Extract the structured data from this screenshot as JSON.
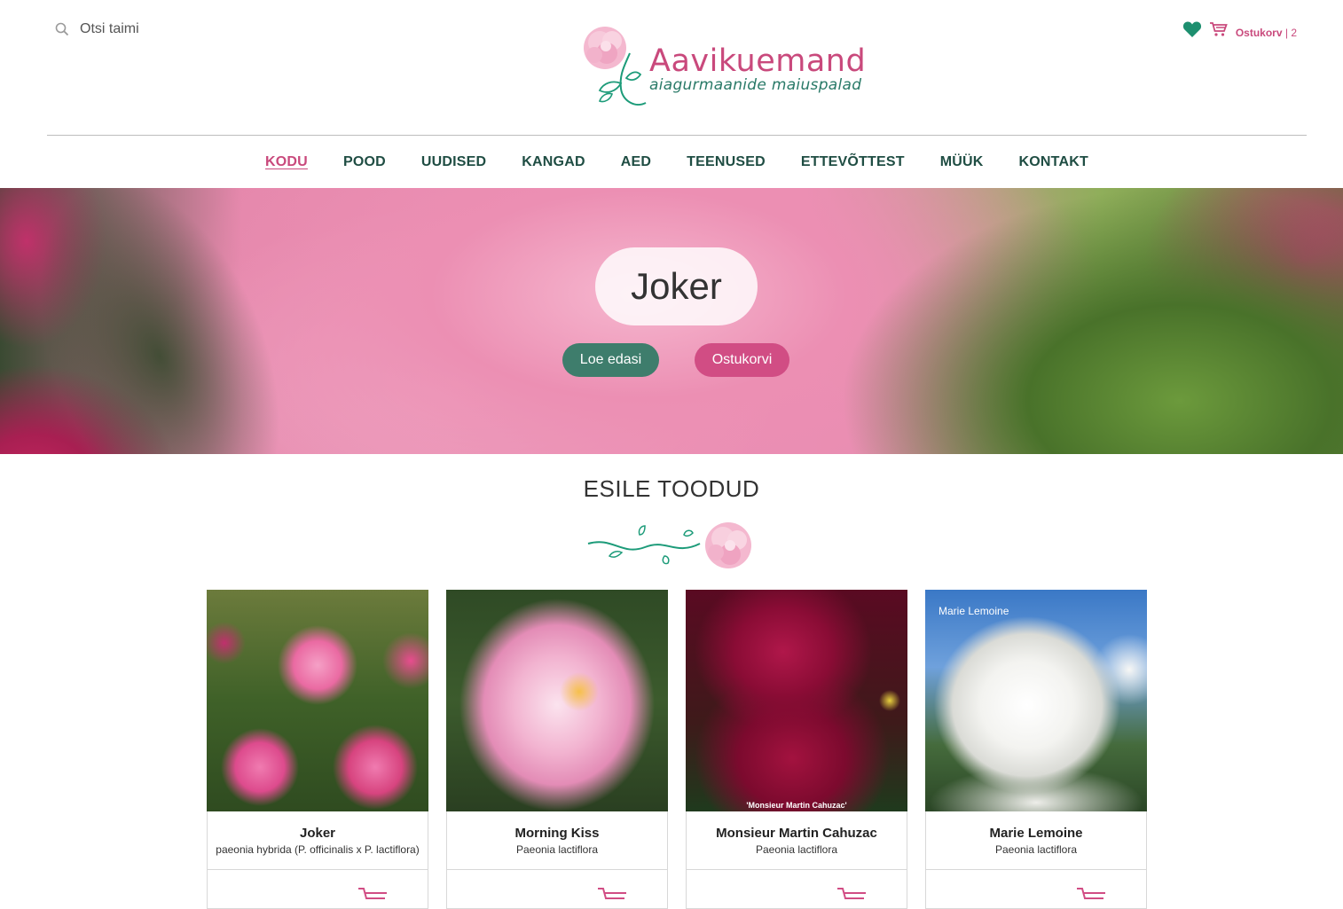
{
  "search": {
    "placeholder": "Otsi taimi"
  },
  "brand": {
    "name": "Aavikuemand",
    "tagline": "aiagurmaanide maiuspalad",
    "color": "#c9497c"
  },
  "header": {
    "cart_label": "Ostukorv",
    "cart_sep": " | ",
    "cart_count": "2"
  },
  "nav": {
    "items": [
      {
        "label": "KODU",
        "active": true
      },
      {
        "label": "POOD"
      },
      {
        "label": "UUDISED"
      },
      {
        "label": "KANGAD"
      },
      {
        "label": "AED"
      },
      {
        "label": "TEENUSED"
      },
      {
        "label": "ETTEVÕTTEST"
      },
      {
        "label": "MÜÜK"
      },
      {
        "label": "KONTAKT"
      }
    ]
  },
  "hero": {
    "title": "Joker",
    "read_more": "Loe edasi",
    "add_to_cart": "Ostukorvi"
  },
  "featured": {
    "title": "ESILE TOODUD",
    "products": [
      {
        "name": "Joker",
        "latin": "paeonia hybrida (P. officinalis x P. lactiflora)",
        "caption": ""
      },
      {
        "name": "Morning Kiss",
        "latin": "Paeonia lactiflora",
        "caption": ""
      },
      {
        "name": "Monsieur Martin Cahuzac",
        "latin": "Paeonia lactiflora",
        "caption": "'Monsieur Martin Cahuzac'"
      },
      {
        "name": "Marie Lemoine",
        "latin": "Paeonia lactiflora",
        "caption": "Marie Lemoine"
      }
    ]
  },
  "colors": {
    "green": "#1f4d43",
    "pink": "#c9497c",
    "button_green": "#3e7d6c",
    "button_pink": "#d14d84"
  }
}
